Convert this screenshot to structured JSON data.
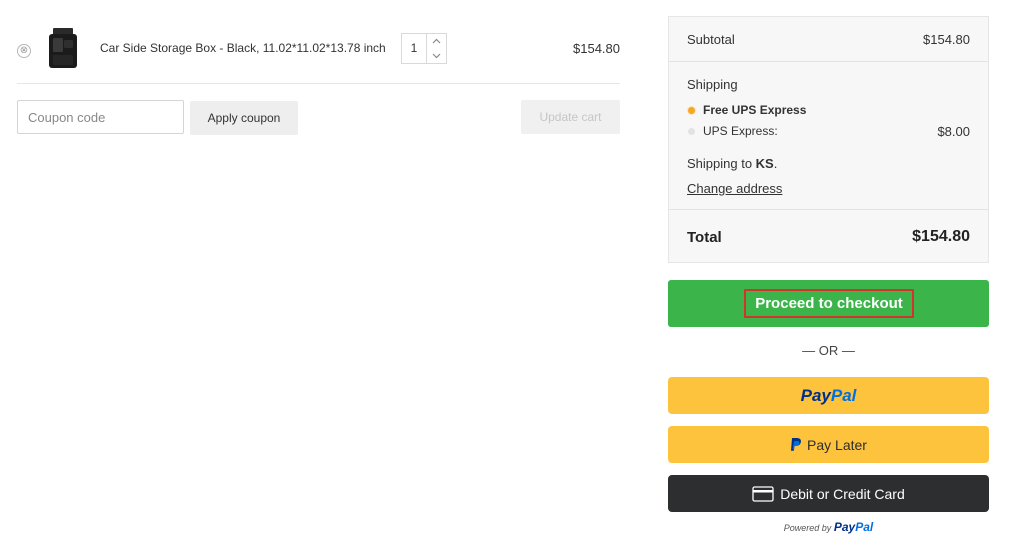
{
  "cart": {
    "item": {
      "remove_label": "⊗",
      "name": "Car Side Storage Box - Black, 11.02*11.02*13.78 inch",
      "quantity": "1",
      "price": "$154.80"
    },
    "coupon": {
      "placeholder": "Coupon code",
      "apply_label": "Apply coupon"
    },
    "update_label": "Update cart"
  },
  "totals": {
    "subtotal_label": "Subtotal",
    "subtotal_value": "$154.80",
    "shipping_label": "Shipping",
    "options": [
      {
        "label": "Free UPS Express",
        "price": "",
        "selected": true
      },
      {
        "label": "UPS Express:",
        "price": "$8.00",
        "selected": false
      }
    ],
    "shipping_to_prefix": "Shipping to ",
    "shipping_to_region": "KS",
    "shipping_to_suffix": ".",
    "change_address_label": "Change address",
    "total_label": "Total",
    "total_value": "$154.80"
  },
  "checkout": {
    "proceed_label": "Proceed to checkout",
    "or_label": "— OR —",
    "paypal_pay": "Pay",
    "paypal_pal": "Pal",
    "pay_later_label": "Pay Later",
    "card_label": "Debit or Credit Card",
    "powered_by": "Powered by",
    "powered_pay": "Pay",
    "powered_pal": "Pal"
  },
  "colors": {
    "checkout_green": "#3bb54a",
    "highlight_red": "#d0342c",
    "paypal_yellow": "#fec33c",
    "card_black": "#2c2e2f",
    "paypal_navy": "#003087",
    "paypal_blue": "#0070e0",
    "radio_active": "#f6a821"
  },
  "icons": {
    "remove": "circle-x-icon",
    "quantity_up": "chevron-up-icon",
    "quantity_down": "chevron-down-icon",
    "pay_later": "paypal-p-icon",
    "card": "credit-card-icon"
  }
}
